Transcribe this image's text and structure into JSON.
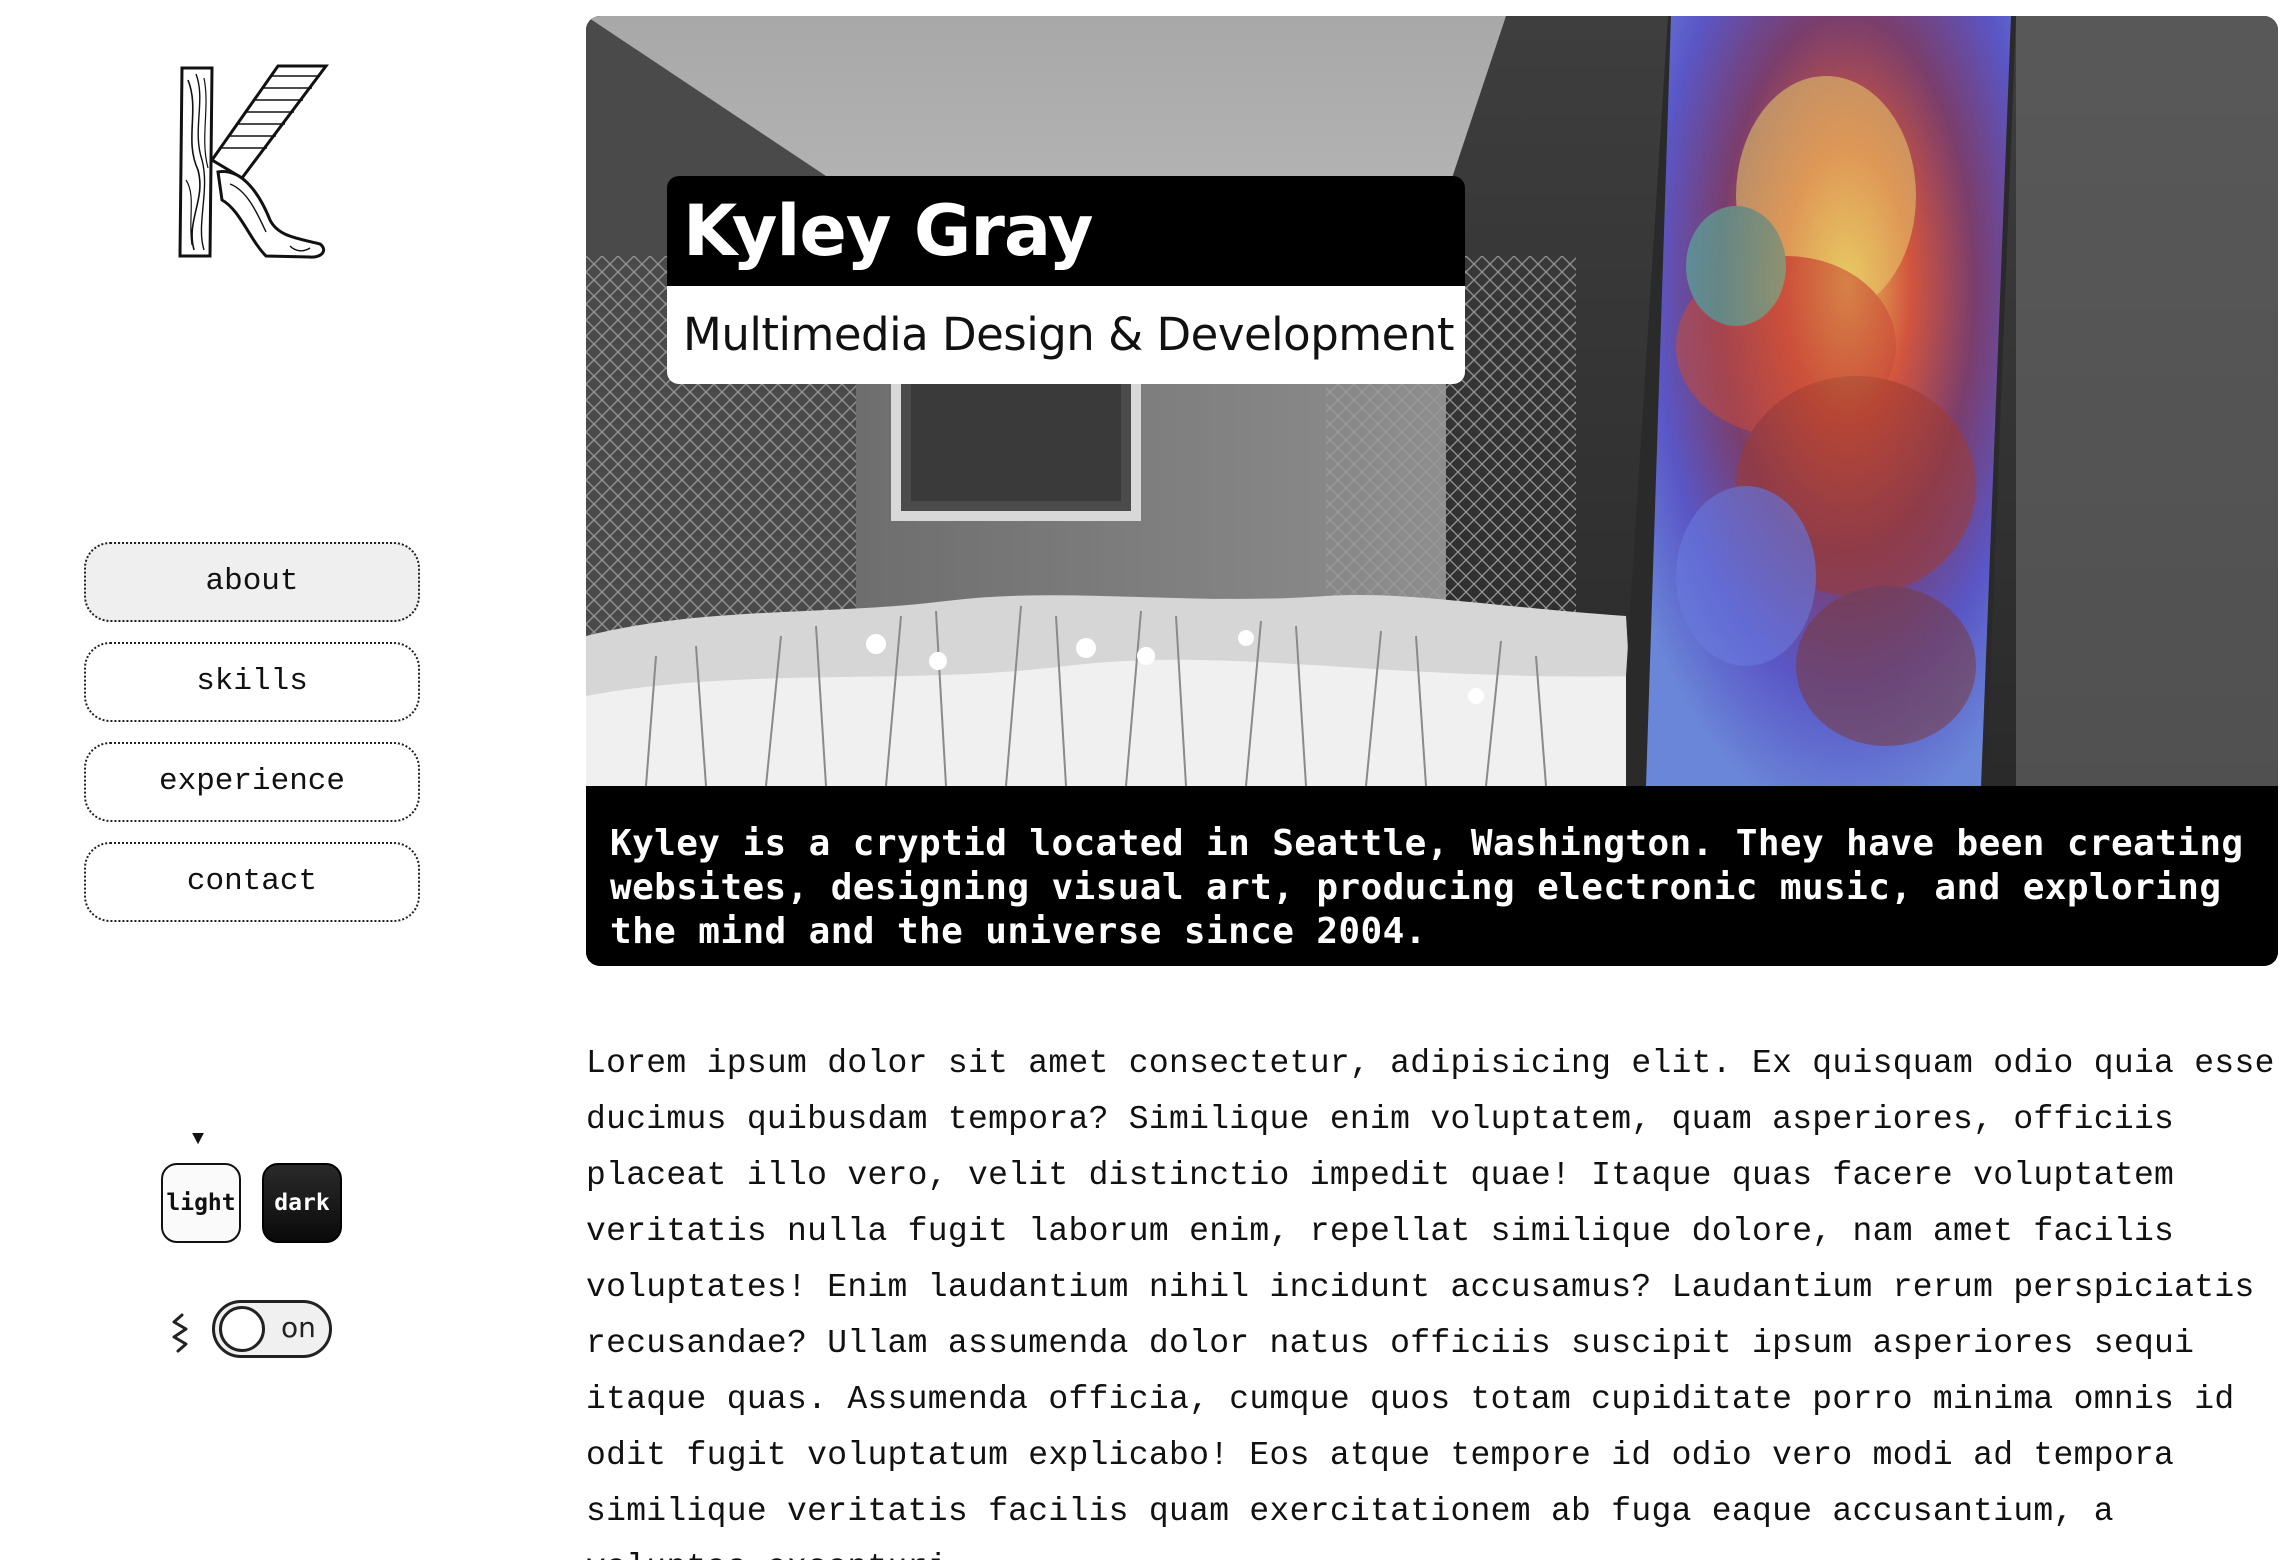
{
  "nav": {
    "items": [
      {
        "label": "about",
        "active": true
      },
      {
        "label": "skills",
        "active": false
      },
      {
        "label": "experience",
        "active": false
      },
      {
        "label": "contact",
        "active": false
      }
    ]
  },
  "theme": {
    "light_label": "light",
    "dark_label": "dark",
    "selected": "light"
  },
  "motion": {
    "toggle_label": "on",
    "icon": "squiggle-icon"
  },
  "hero": {
    "name": "Kyley Gray",
    "subtitle": "Multimedia Design & Development",
    "bio": "Kyley is a cryptid located in Seattle, Washington. They have been creating websites, designing visual art, producing electronic music, and exploring the mind and the universe since 2004."
  },
  "body": {
    "text": "Lorem ipsum dolor sit amet consectetur, adipisicing elit. Ex quisquam odio quia esse ducimus quibusdam tempora? Similique enim voluptatem, quam asperiores, officiis placeat illo vero, velit distinctio impedit quae! Itaque quas facere voluptatem veritatis nulla fugit laborum enim, repellat similique dolore, nam amet facilis voluptates! Enim laudantium nihil incidunt accusamus? Laudantium rerum perspiciatis recusandae? Ullam assumenda dolor natus officiis suscipit ipsum asperiores sequi itaque quas. Assumenda officia, cumque quos totam cupiditate porro minima omnis id odit fugit voluptatum explicabo! Eos atque tempore id odio vero modi ad tempora similique veritatis facilis quam exercitationem ab fuga eaque accusantium, a voluptas excepturi."
  },
  "colors": {
    "background": "#ffffff",
    "ink": "#111111",
    "hero_black": "#000000",
    "active_nav": "#efefef"
  }
}
